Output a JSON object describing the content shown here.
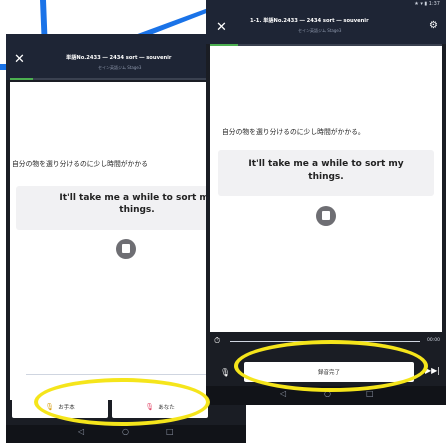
{
  "left_phone": {
    "status_bar": "★ ▾ ▮",
    "close_label": "✕",
    "title": "単語No.2433 ― 2434 sort ― souvenir",
    "subtitle": "セイン英語ジム Stage3",
    "progress": 0.1,
    "japanese_sentence": "自分の物を選り分けるのに少し時間がかかる",
    "english_sentence": "It'll take me a while to sort my\nthings.",
    "timer_icon": "⏱",
    "button_model_label": "お手本",
    "button_you_label": "あなた",
    "nav_back": "◁",
    "nav_home": "○",
    "nav_recent": "□"
  },
  "right_phone": {
    "status_bar": "★ ▾ ▮ 1:37",
    "close_label": "✕",
    "title": "1-1. 単語No.2433 ― 2434 sort ― souvenir",
    "subtitle": "セイン英語ジム Stage3",
    "gear_label": "⚙",
    "progress": 0.12,
    "japanese_sentence": "自分の物を選り分けるのに少し時間がかかる。",
    "english_sentence": "It'll take me a while to sort my\nthings.",
    "timer_icon": "⏱",
    "time_readout": "00:00",
    "record_done_label": "録音完了",
    "mic_icon": "🎙",
    "skip_icon": "▶▶|",
    "nav_back": "◁",
    "nav_home": "○",
    "nav_recent": "□"
  },
  "colors": {
    "highlight": "#f5e51b",
    "callout": "#1a73e8",
    "accent_green": "#4caf50",
    "header_bg": "#1e2535"
  }
}
